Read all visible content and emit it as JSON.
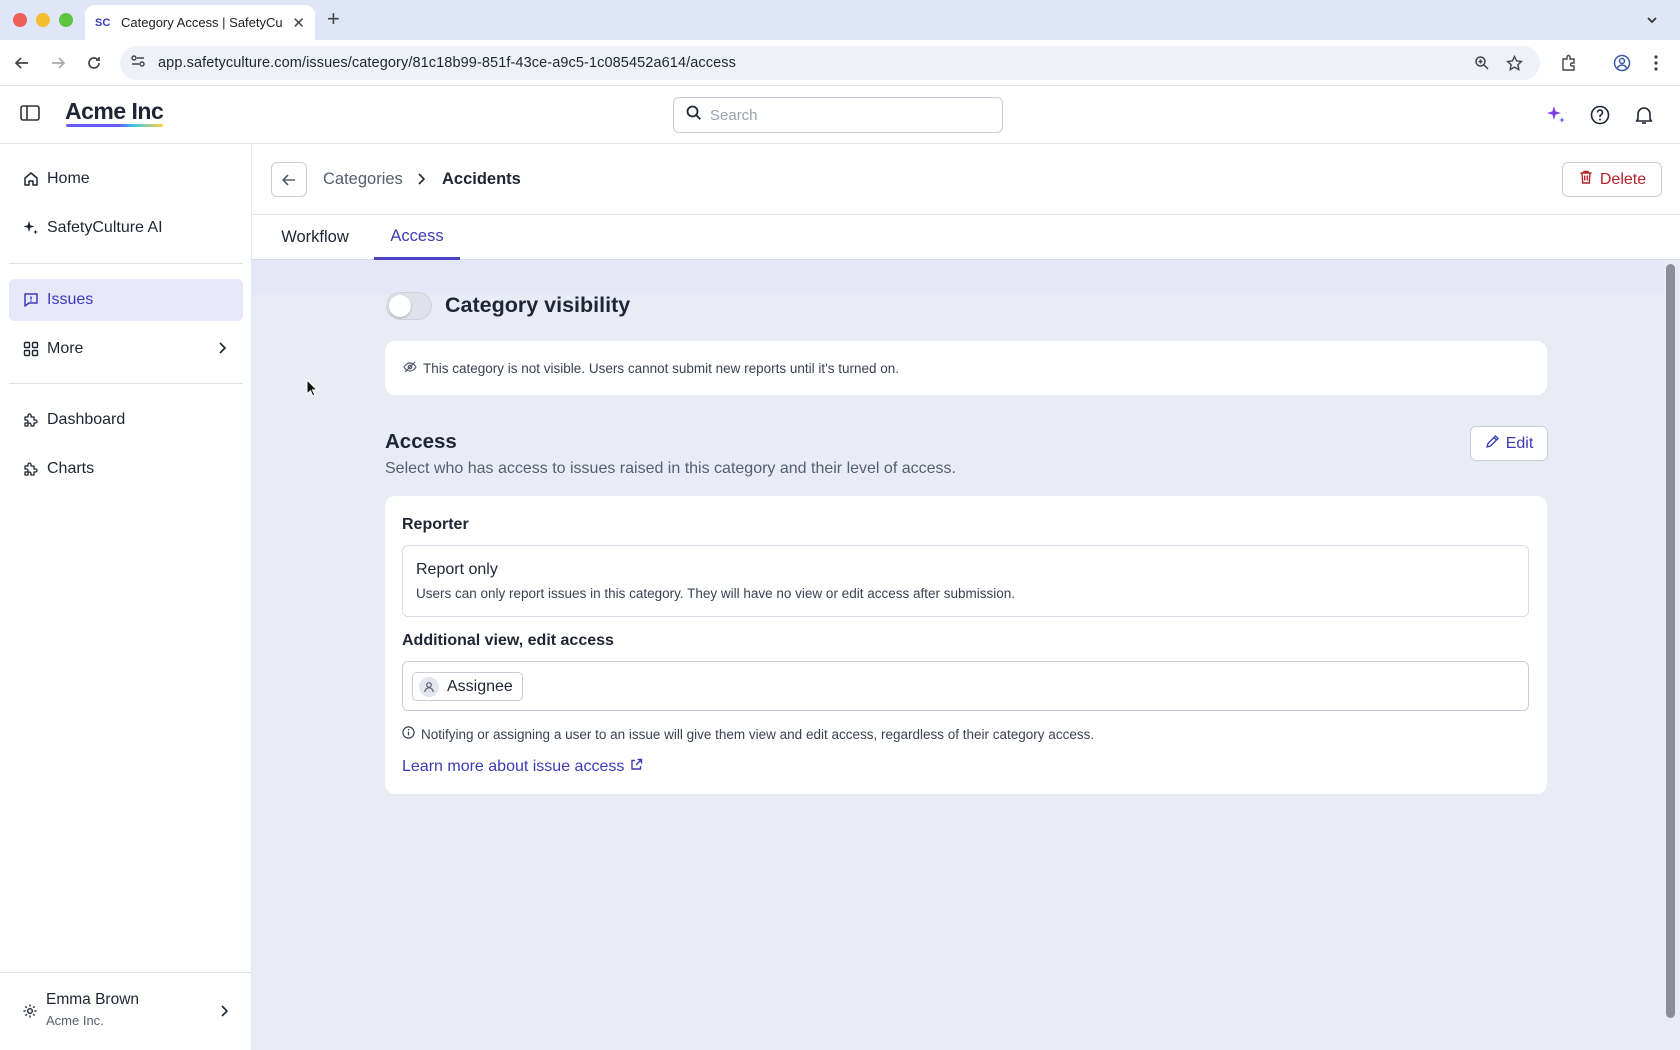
{
  "browser": {
    "tab_title": "Category Access | SafetyCulture",
    "tab_favicon": "SC",
    "url": "app.safetyculture.com/issues/category/81c18b99-851f-43ce-a9c5-1c085452a614/access"
  },
  "header": {
    "logo": "Acme Inc",
    "search_placeholder": "Search"
  },
  "sidebar": {
    "items": [
      {
        "label": "Home",
        "icon": "home-icon"
      },
      {
        "label": "SafetyCulture AI",
        "icon": "sparkle-icon"
      },
      {
        "label": "Issues",
        "icon": "issue-icon",
        "active": true
      },
      {
        "label": "More",
        "icon": "grid-icon"
      },
      {
        "label": "Dashboard",
        "icon": "puzzle-icon"
      },
      {
        "label": "Charts",
        "icon": "puzzle-icon"
      }
    ],
    "user": {
      "name": "Emma Brown",
      "org": "Acme Inc."
    }
  },
  "breadcrumb": {
    "parent": "Categories",
    "current": "Accidents"
  },
  "actions": {
    "delete_label": "Delete",
    "edit_label": "Edit"
  },
  "tabs": [
    {
      "label": "Workflow"
    },
    {
      "label": "Access",
      "active": true
    }
  ],
  "visibility": {
    "title": "Category visibility",
    "enabled": false,
    "notice": "This category is not visible. Users cannot submit new reports until it's turned on."
  },
  "access": {
    "title": "Access",
    "description": "Select who has access to issues raised in this category and their level of access.",
    "reporter_label": "Reporter",
    "reporter_option_title": "Report only",
    "reporter_option_desc": "Users can only report issues in this category. They will have no view or edit access after submission.",
    "additional_label": "Additional view, edit access",
    "assignee_chip": "Assignee",
    "info_text": "Notifying or assigning a user to an issue will give them view and edit access, regardless of their category access.",
    "learn_more": "Learn more about issue access"
  },
  "colors": {
    "accent": "#3d3ab5",
    "danger": "#b4232a",
    "main_bg": "#e9ecf5"
  }
}
